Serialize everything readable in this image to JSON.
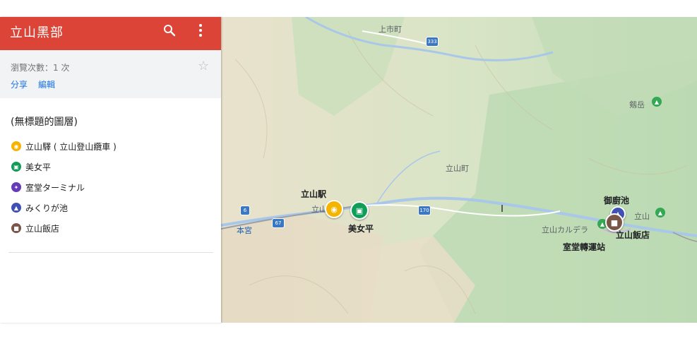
{
  "panel": {
    "title": "立山黑部",
    "views": "瀏覽次數：1 次",
    "share": "分享",
    "edit": "編輯",
    "layer_title": "(無標題的圖層)",
    "items": [
      {
        "label": "立山驛 ( 立山登山纜車 )",
        "color": "#f4b400"
      },
      {
        "label": "美女平",
        "color": "#0f9d58"
      },
      {
        "label": "室堂ターミナル",
        "color": "#673ab7"
      },
      {
        "label": "みくりが池",
        "color": "#3f51b5"
      },
      {
        "label": "立山飯店",
        "color": "#795548"
      }
    ]
  },
  "map": {
    "labels": {
      "kamiichi": "上市町",
      "route333": "333",
      "tsurugi": "剱岳",
      "tateyamamachi": "立山町",
      "tateyama_station": "立山駅",
      "tateyama_small": "立山",
      "bijodaira": "美女平",
      "route170": "170",
      "route6": "6",
      "route67": "67",
      "honmiya": "本宮",
      "mikurigaike": "御廚池",
      "tateyama_peak": "立山",
      "caldera": "立山カルデラ",
      "hotel": "立山飯店",
      "murodo": "室堂轉運站"
    }
  }
}
